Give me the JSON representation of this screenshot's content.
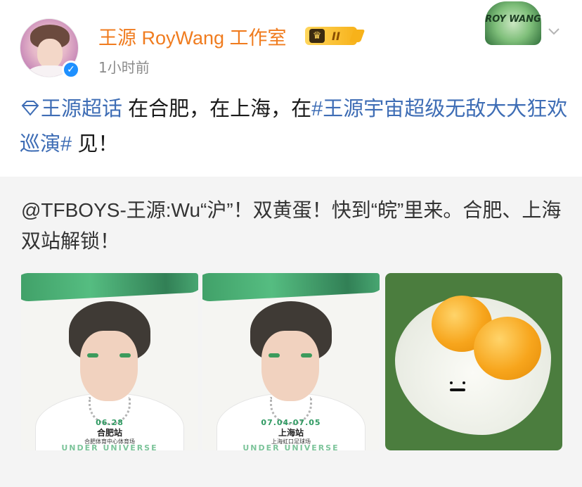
{
  "account": {
    "name": "王源 RoyWang 工作室",
    "level_badge": "II",
    "timestamp": "1小时前"
  },
  "decoration": {
    "text": "ROY WANG"
  },
  "post": {
    "topic": "王源超话",
    "segment1": " 在合肥，在上海，在",
    "hashtag": "#王源宇宙超级无敌大大狂欢巡演#",
    "segment2": " 见！"
  },
  "repost": {
    "mention": "@TFBOYS-王源",
    "text": ":Wu“沪”！双黄蛋！快到“皖”里来。合肥、上海双站解锁！"
  },
  "images": [
    {
      "date": "06.28",
      "station": "合肥站",
      "venue": "合肥体育中心体育场",
      "brand": "UNDER UNIVERSE"
    },
    {
      "date": "07.04-07.05",
      "station": "上海站",
      "venue": "上海虹口足球场",
      "brand": "UNDER UNIVERSE"
    },
    {
      "description": "double-yolk-egg"
    }
  ],
  "colors": {
    "username": "#f07c1f",
    "link": "#3e6db5",
    "verified": "#1e90ff",
    "repost_bg": "#f4f4f4"
  },
  "icons": [
    "verified-icon",
    "level-badge-icon",
    "chevron-down-icon",
    "super-topic-diamond-icon"
  ]
}
